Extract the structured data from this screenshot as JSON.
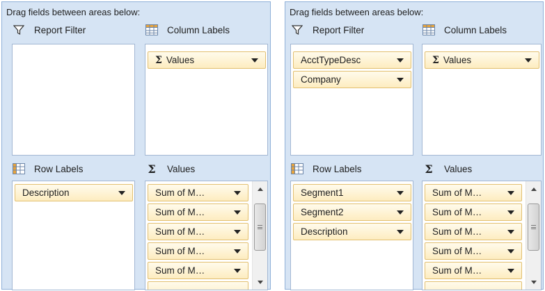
{
  "panels": [
    {
      "title": "Drag fields between areas below:",
      "areas": {
        "report_filter": {
          "label": "Report Filter",
          "fields": []
        },
        "column_labels": {
          "label": "Column Labels",
          "fields": [
            {
              "label": "Values",
              "sigma": "Σ"
            }
          ]
        },
        "row_labels": {
          "label": "Row Labels",
          "fields": [
            "Description"
          ]
        },
        "values": {
          "label": "Values",
          "sigma": "Σ",
          "fields": [
            "Sum of M…",
            "Sum of M…",
            "Sum of M…",
            "Sum of M…",
            "Sum of M…"
          ]
        }
      }
    },
    {
      "title": "Drag fields between areas below:",
      "areas": {
        "report_filter": {
          "label": "Report Filter",
          "fields": [
            "AcctTypeDesc",
            "Company"
          ]
        },
        "column_labels": {
          "label": "Column Labels",
          "fields": [
            {
              "label": "Values",
              "sigma": "Σ"
            }
          ]
        },
        "row_labels": {
          "label": "Row Labels",
          "fields": [
            "Segment1",
            "Segment2",
            "Description"
          ]
        },
        "values": {
          "label": "Values",
          "sigma": "Σ",
          "fields": [
            "Sum of M…",
            "Sum of M…",
            "Sum of M…",
            "Sum of M…",
            "Sum of M…"
          ]
        }
      }
    }
  ],
  "icons": {
    "filter": "funnel-icon",
    "column": "column-grid-icon",
    "row": "row-grid-icon",
    "values": "sigma-icon",
    "scroll_up": "scroll-up-arrow-icon",
    "scroll_down": "scroll-down-arrow-icon"
  },
  "colors": {
    "panel_bg": "#d6e4f4",
    "field_bg": "#fdecc0",
    "field_border": "#e2bf6f"
  }
}
